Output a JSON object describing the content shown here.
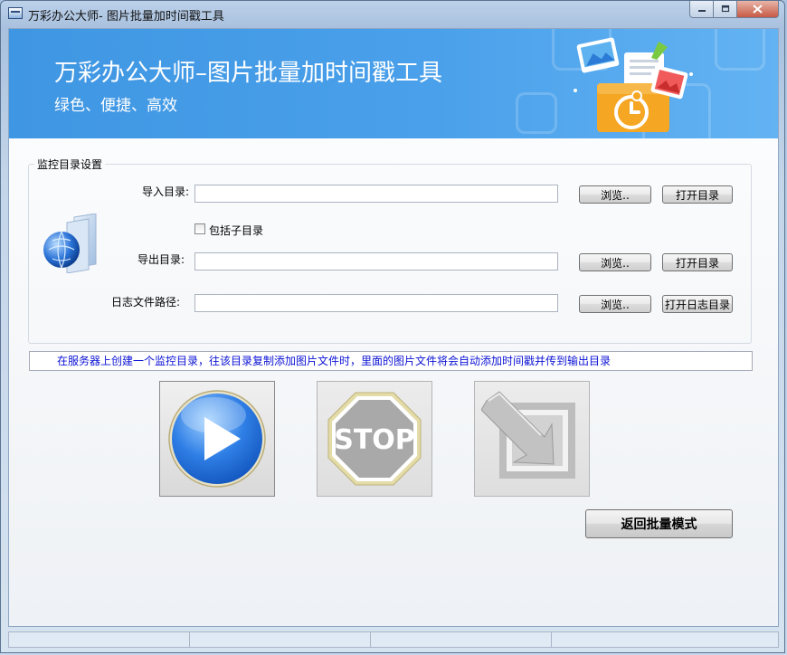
{
  "window": {
    "title": "万彩办公大师- 图片批量加时间戳工具"
  },
  "banner": {
    "title": "万彩办公大师–图片批量加时间戳工具",
    "subtitle": "绿色、便捷、高效"
  },
  "monitor": {
    "group_title": "监控目录设置",
    "import_label": "导入目录:",
    "import_value": "",
    "include_subdirs_label": "包括子目录",
    "include_subdirs_checked": false,
    "export_label": "导出目录:",
    "export_value": "",
    "log_label": "日志文件路径:",
    "log_value": "",
    "browse_label": "浏览..",
    "open_dir_label": "打开目录",
    "open_log_dir_label": "打开日志目录"
  },
  "hint": "在服务器上创建一个监控目录，往该目录复制添加图片文件时，里面的图片文件将会自动添加时间戳并传到输出目录",
  "actions": {
    "stop_text": "STOP",
    "return_label": "返回批量模式"
  },
  "colors": {
    "banner": "#4aa0ea",
    "hint_text": "#0b12d4",
    "play_blue": "#2f7fe6",
    "stop_gray": "#a9a9a9"
  }
}
